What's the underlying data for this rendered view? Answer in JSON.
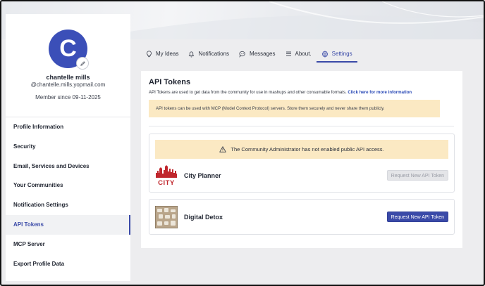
{
  "profile": {
    "initial": "C",
    "name": "chantelle mills",
    "email": "@chantelle.mills.yopmail.com",
    "member_since": "Member since 09-11-2025"
  },
  "sidebar": {
    "items": [
      {
        "label": "Profile Information"
      },
      {
        "label": "Security"
      },
      {
        "label": "Email, Services and Devices"
      },
      {
        "label": "Your Communities"
      },
      {
        "label": "Notification Settings"
      },
      {
        "label": "API Tokens"
      },
      {
        "label": "MCP Server"
      },
      {
        "label": "Export Profile Data"
      }
    ],
    "active_index": 5
  },
  "tabs": [
    {
      "label": "My Ideas",
      "icon": "lightbulb-icon"
    },
    {
      "label": "Notifications",
      "icon": "bell-icon"
    },
    {
      "label": "Messages",
      "icon": "chat-bubble-icon"
    },
    {
      "label": "About.",
      "icon": "menu-lines-icon"
    },
    {
      "label": "Settings",
      "icon": "gear-icon"
    }
  ],
  "active_tab": "Settings",
  "main": {
    "title": "API Tokens",
    "description": "API Tokens are used to get data from the community for use in mashups and other consumable formats.",
    "info_link": "Click here for more information",
    "mcp_note": "API tokens can be used with MCP (Model Context Protocol) servers. Store them securely and never share them publicly.",
    "admin_alert": "The Community Administrator has not enabled public API access.",
    "apps": [
      {
        "name": "City Planner",
        "logo_text": "CITY",
        "button": "Request New API Token",
        "enabled": false
      },
      {
        "name": "Digital Detox",
        "button": "Request New API Token",
        "enabled": true
      }
    ]
  },
  "colors": {
    "accent": "#3a4aa8",
    "avatar": "#3b4fb8",
    "warning_bg": "#fbe9c3",
    "city_red": "#c0262c"
  }
}
